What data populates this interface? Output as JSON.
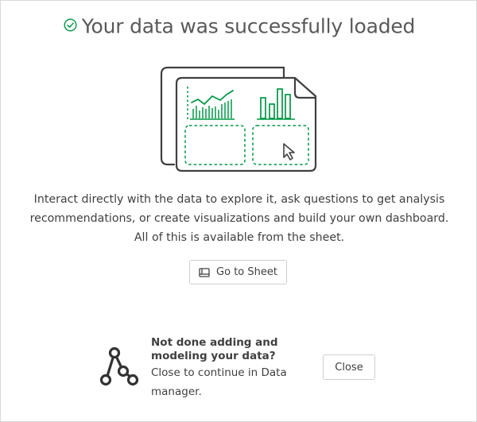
{
  "dialog": {
    "title": "Your data was successfully loaded",
    "status_icon": "check-circle-icon",
    "accent_color": "#009845",
    "illustration_icon": "sheet-illustration-icon",
    "description": "Interact directly with the data to explore it, ask questions to get analysis recommendations, or create visualizations and build your own dashboard. All of this is available from the sheet.",
    "goto_button": {
      "label": "Go to Sheet",
      "icon": "sheet-icon"
    },
    "footer": {
      "icon": "data-model-icon",
      "heading": "Not done adding and modeling your data?",
      "subtext": "Close to continue in Data manager.",
      "close_label": "Close"
    }
  }
}
